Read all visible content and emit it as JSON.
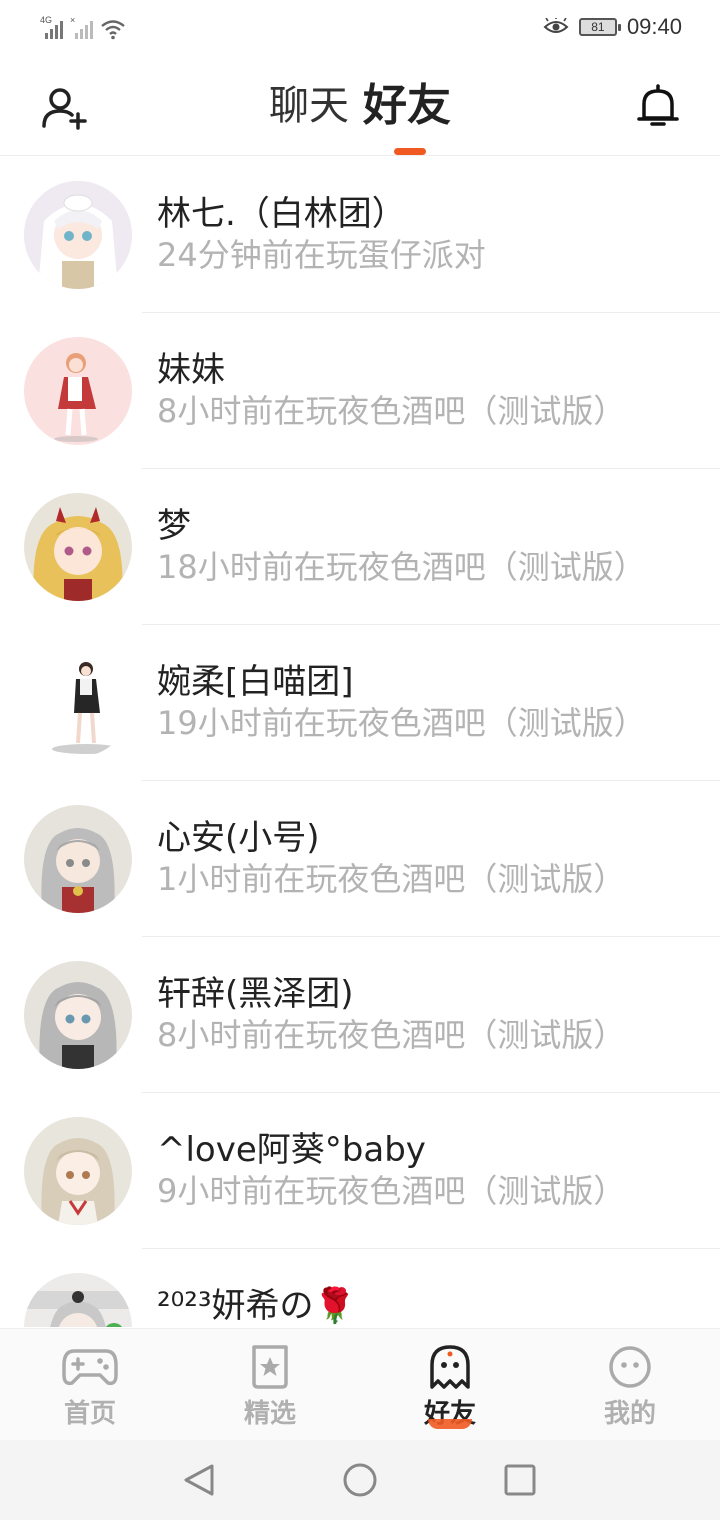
{
  "status_bar": {
    "network_1": "4G",
    "network_2": "×",
    "battery_level": "81",
    "time": "09:40",
    "icons": [
      "signal-icon",
      "signal-icon",
      "wifi-icon",
      "eye-comfort-icon",
      "battery-icon"
    ]
  },
  "header": {
    "tabs": [
      {
        "label": "聊天",
        "active": false
      },
      {
        "label": "好友",
        "active": true
      }
    ],
    "left_icon": "add-friend-icon",
    "right_icon": "bell-icon",
    "accent_color": "#f05a22"
  },
  "friends": [
    {
      "name": "林七.（白林团）",
      "status": "24分钟前在玩蛋仔派对"
    },
    {
      "name": "妹妹",
      "status": "8小时前在玩夜色酒吧（测试版）"
    },
    {
      "name": "梦",
      "status": "18小时前在玩夜色酒吧（测试版）"
    },
    {
      "name": "婉柔[白喵团]",
      "status": "19小时前在玩夜色酒吧（测试版）"
    },
    {
      "name": "心安(小号)",
      "status": "1小时前在玩夜色酒吧（测试版）"
    },
    {
      "name": "轩辞(黑泽团)",
      "status": "8小时前在玩夜色酒吧（测试版）"
    },
    {
      "name": "^love阿葵°baby",
      "status": "9小时前在玩夜色酒吧（测试版）"
    },
    {
      "name": "²⁰²³妍希の🌹",
      "status": ""
    }
  ],
  "bottom_nav": [
    {
      "label": "首页",
      "icon": "gamepad-icon",
      "active": false
    },
    {
      "label": "精选",
      "icon": "star-bookmark-icon",
      "active": false
    },
    {
      "label": "好友",
      "icon": "ghost-icon",
      "active": true
    },
    {
      "label": "我的",
      "icon": "smiley-icon",
      "active": false
    }
  ],
  "system_nav": [
    "back-icon",
    "home-icon",
    "recents-icon"
  ]
}
